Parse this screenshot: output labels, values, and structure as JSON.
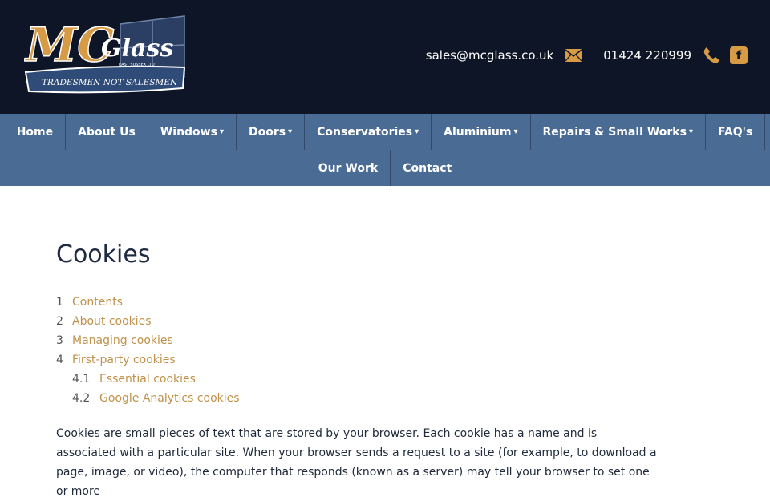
{
  "brand": {
    "logo_main": "MC",
    "logo_sub": "Glass",
    "logo_location": "EAST SUSSEX LTD",
    "logo_tagline": "TRADESMEN NOT SALESMEN"
  },
  "contact": {
    "email": "sales@mcglass.co.uk",
    "phone": "01424 220999"
  },
  "nav": {
    "row1": [
      {
        "label": "Home",
        "dropdown": false
      },
      {
        "label": "About Us",
        "dropdown": false
      },
      {
        "label": "Windows",
        "dropdown": true
      },
      {
        "label": "Doors",
        "dropdown": true
      },
      {
        "label": "Conservatories",
        "dropdown": true
      },
      {
        "label": "Aluminium",
        "dropdown": true
      },
      {
        "label": "Repairs & Small Works",
        "dropdown": true
      },
      {
        "label": "FAQ's",
        "dropdown": false
      }
    ],
    "row2": [
      {
        "label": "Our Work",
        "dropdown": false
      },
      {
        "label": "Contact",
        "dropdown": false
      }
    ],
    "caret": "▾"
  },
  "page": {
    "title": "Cookies",
    "toc": [
      {
        "num": "1",
        "label": "Contents"
      },
      {
        "num": "2",
        "label": "About cookies"
      },
      {
        "num": "3",
        "label": "Managing cookies"
      },
      {
        "num": "4",
        "label": "First-party cookies"
      },
      {
        "num": "4.1",
        "label": "Essential cookies"
      },
      {
        "num": "4.2",
        "label": "Google Analytics cookies"
      }
    ],
    "intro": "Cookies are small pieces of text that are stored by your browser. Each cookie has a name and is associated with a particular site. When your browser sends a request to a site (for example, to download a page, image, or video), the computer that responds (known as a server) may tell your browser to set one or more"
  },
  "colors": {
    "header_bg": "#0d1526",
    "nav_bg": "#4a6b94",
    "link": "#c0914a",
    "accent": "#d79a45"
  },
  "icons": {
    "email": "envelope-icon",
    "phone": "phone-icon",
    "facebook": "facebook-icon",
    "facebook_glyph": "f"
  }
}
